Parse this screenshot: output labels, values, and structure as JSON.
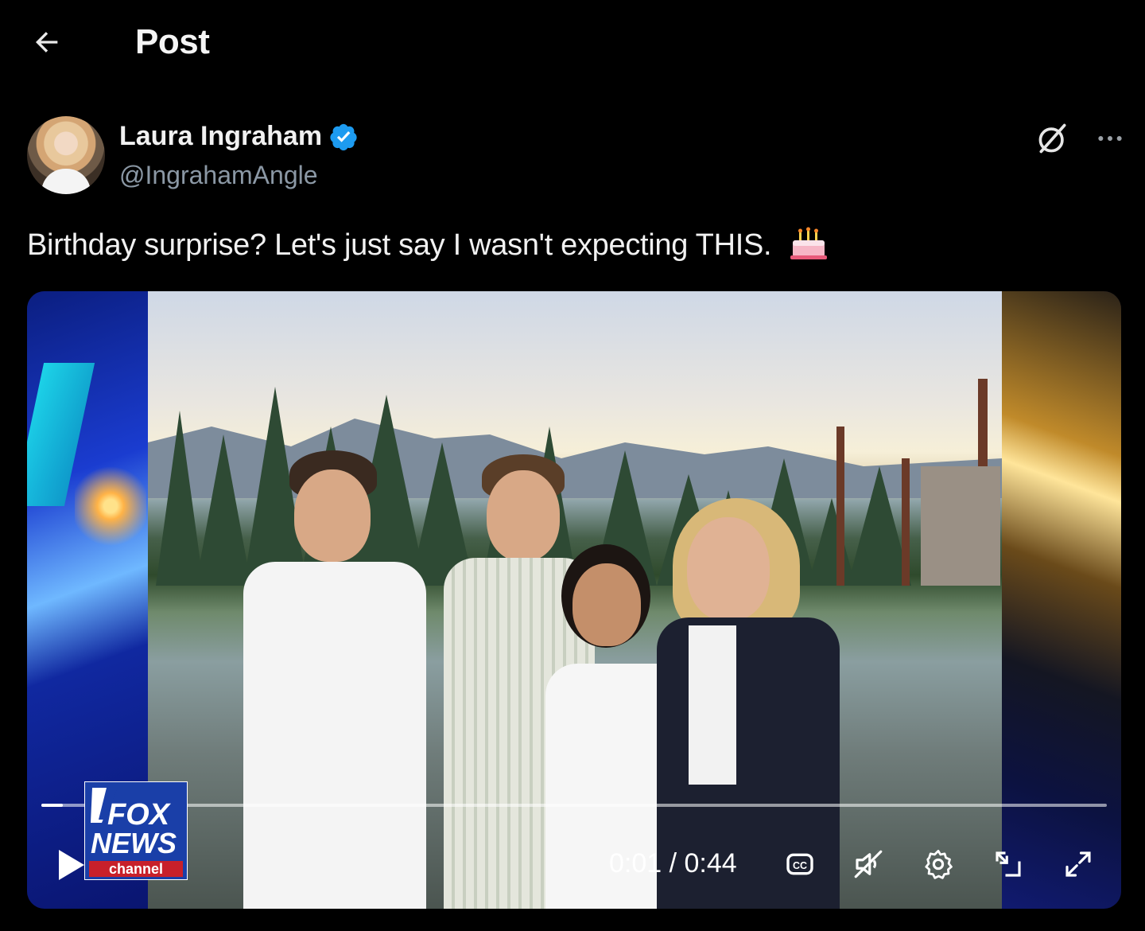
{
  "header": {
    "title": "Post",
    "back_icon": "arrow-left-icon"
  },
  "author": {
    "name": "Laura Ingraham",
    "handle": "@IngrahamAngle",
    "verified": true,
    "verified_color": "#1d9bf0",
    "avatar_icon": "profile-photo"
  },
  "actions": {
    "grok_icon": "grok-icon",
    "more_icon": "more-horizontal-icon"
  },
  "post": {
    "text": "Birthday surprise? Let's just say I wasn't expecting THIS.",
    "emoji_icon": "birthday-cake-icon"
  },
  "video": {
    "logo_lines": [
      "FOX",
      "NEWS",
      "channel"
    ],
    "current_time": "0:01",
    "total_time": "0:44",
    "time_display": "0:01 / 0:44",
    "progress": 0.02,
    "controls": [
      "play-icon",
      "captions-icon",
      "mute-icon",
      "settings-icon",
      "pip-icon",
      "fullscreen-icon"
    ]
  },
  "colors": {
    "background": "#000000",
    "text": "#e7e9ea",
    "secondary_text": "#8b98a5",
    "accent": "#1d9bf0"
  }
}
